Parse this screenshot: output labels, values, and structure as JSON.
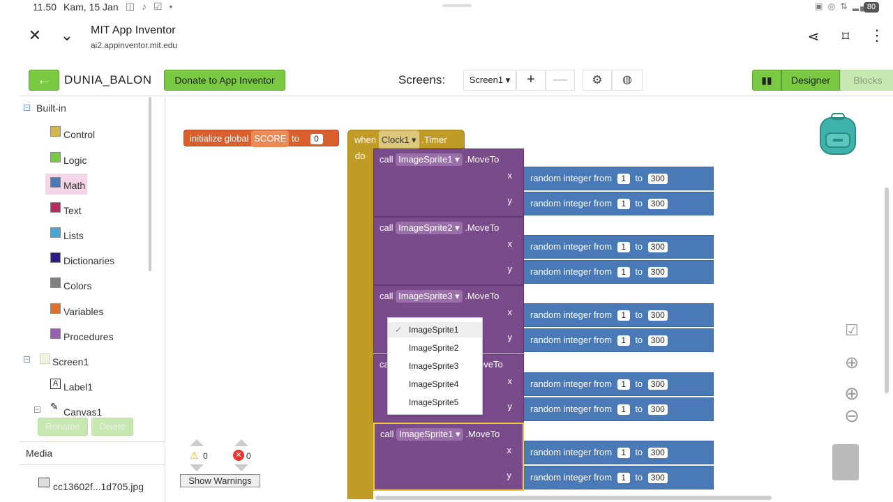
{
  "status_bar": {
    "time": "11.50",
    "date": "Kam, 15 Jan",
    "battery": "80"
  },
  "browser": {
    "site_title": "MIT App Inventor",
    "url": "ai2.appinventor.mit.edu"
  },
  "appbar": {
    "project_name": "DUNIA_BALON",
    "donate_label": "Donate to App Inventor",
    "screens_label": "Screens:",
    "screen_selected": "Screen1 ▾",
    "add_screen": "+",
    "remove_screen": "—",
    "designer_label": "Designer",
    "blocks_label": "Blocks"
  },
  "sidebar": {
    "builtin_label": "Built-in",
    "categories": [
      {
        "label": "Control",
        "color": "#d6b54a"
      },
      {
        "label": "Logic",
        "color": "#7ac943"
      },
      {
        "label": "Math",
        "color": "#4a79b8"
      },
      {
        "label": "Text",
        "color": "#b32d5e"
      },
      {
        "label": "Lists",
        "color": "#49a6d4"
      },
      {
        "label": "Dictionaries",
        "color": "#2d1b8a"
      },
      {
        "label": "Colors",
        "color": "#7f7f7f"
      },
      {
        "label": "Variables",
        "color": "#e07030"
      },
      {
        "label": "Procedures",
        "color": "#9a5eb0"
      }
    ],
    "components": {
      "screen": "Screen1",
      "label": "Label1",
      "canvas": "Canvas1"
    },
    "rename_label": "Rename",
    "delete_label": "Delete",
    "media_label": "Media",
    "media_file": "cc13602f...1d705.jpg"
  },
  "blocks": {
    "init": {
      "text1": "initialize global",
      "var": "SCORE",
      "text2": "to",
      "value": "0"
    },
    "event": {
      "when": "when",
      "component": "Clock1 ▾",
      "event": ".Timer",
      "do": "do"
    },
    "calls": [
      {
        "call": "call",
        "component": "ImageSprite1 ▾",
        "method": ".MoveTo"
      },
      {
        "call": "call",
        "component": "ImageSprite2 ▾",
        "method": ".MoveTo"
      },
      {
        "call": "call",
        "component": "ImageSprite3 ▾",
        "method": ".MoveTo"
      },
      {
        "call": "ca",
        "component": "",
        "method": "oveTo"
      },
      {
        "call": "call",
        "component": "ImageSprite1 ▾",
        "method": ".MoveTo"
      }
    ],
    "x_label": "x",
    "y_label": "y",
    "random": {
      "text1": "random integer from",
      "from": "1",
      "text2": "to",
      "to": "300"
    }
  },
  "dropdown": {
    "options": [
      "ImageSprite1",
      "ImageSprite2",
      "ImageSprite3",
      "ImageSprite4",
      "ImageSprite5"
    ],
    "selected": "ImageSprite1",
    "check": "✓"
  },
  "warnings": {
    "warning_count": "0",
    "error_count": "0",
    "show_warnings_label": "Show Warnings"
  }
}
